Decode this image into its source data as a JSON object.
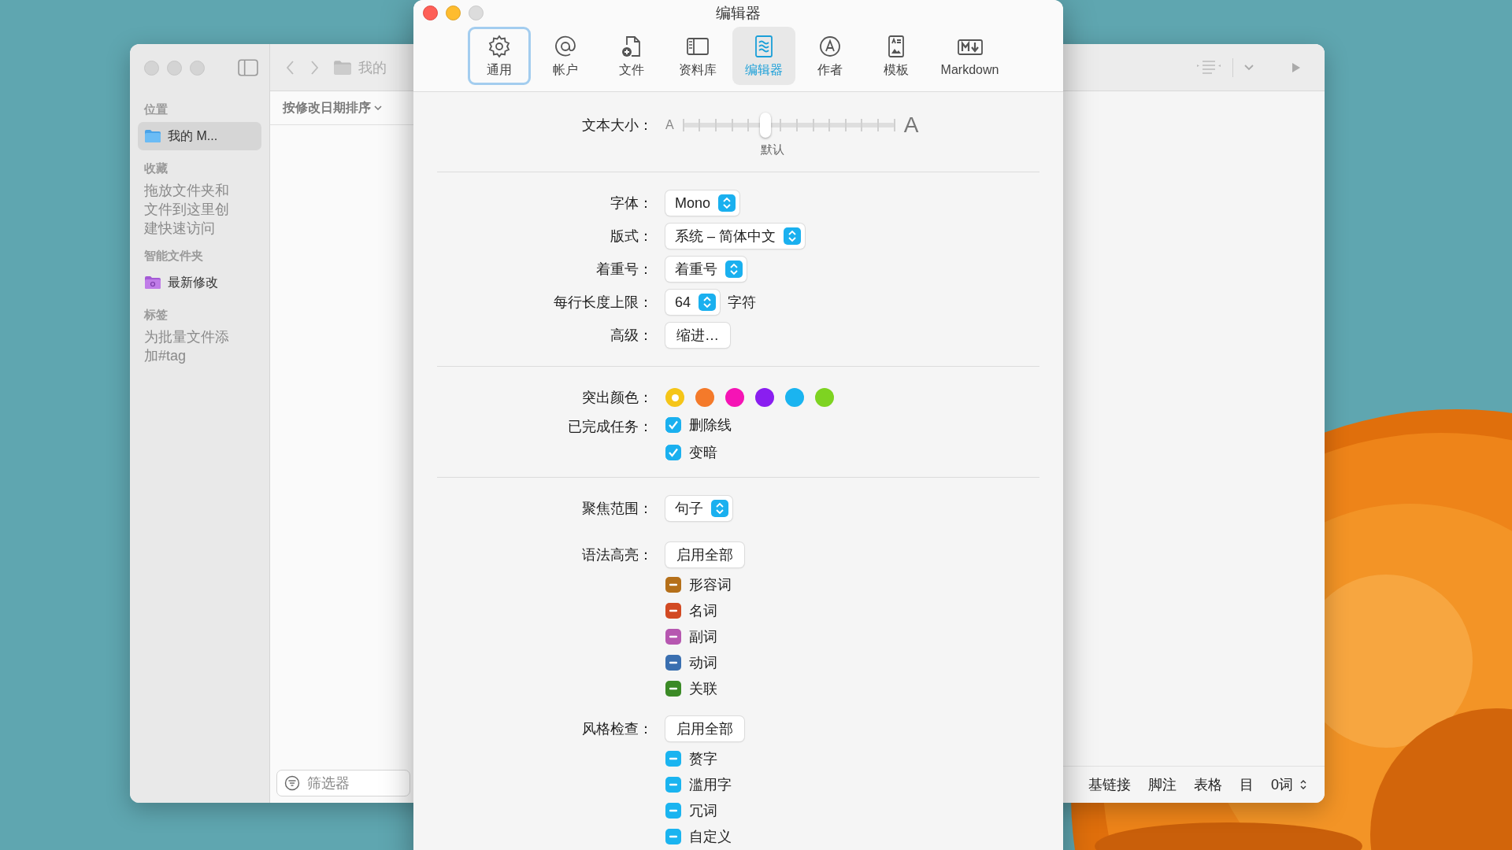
{
  "background_window": {
    "path": "我的",
    "sidebar": {
      "sections": [
        {
          "header": "位置",
          "items": [
            {
              "label": "我的 M...",
              "selected": true,
              "kind": "folder"
            }
          ]
        },
        {
          "header": "收藏",
          "hint": "拖放文件夹和文件到这里创建快速访问"
        },
        {
          "header": "智能文件夹",
          "items": [
            {
              "label": "最新修改",
              "selected": false,
              "kind": "smart"
            }
          ]
        },
        {
          "header": "标签",
          "hint": "为批量文件添加#tag"
        }
      ]
    },
    "sort": "按修改日期排序",
    "filter": {
      "placeholder": "筛选器"
    },
    "status_bar": [
      "基链接",
      "脚注",
      "表格",
      "目"
    ],
    "word_count": "0词"
  },
  "prefs_window": {
    "title": "编辑器",
    "tabs": [
      {
        "label": "通用",
        "selected": false,
        "focused": true
      },
      {
        "label": "帐户",
        "selected": false,
        "focused": false
      },
      {
        "label": "文件",
        "selected": false,
        "focused": false
      },
      {
        "label": "资料库",
        "selected": false,
        "focused": false
      },
      {
        "label": "编辑器",
        "selected": true,
        "focused": false
      },
      {
        "label": "作者",
        "selected": false,
        "focused": false
      },
      {
        "label": "模板",
        "selected": false,
        "focused": false
      },
      {
        "label": "Markdown",
        "selected": false,
        "focused": false
      }
    ],
    "text_size": {
      "label": "文本大小：",
      "small": "A",
      "large": "A",
      "level": 0.39,
      "caption": "默认"
    },
    "popups": [
      {
        "label": "字体：",
        "value": "Mono"
      },
      {
        "label": "版式：",
        "value": "系统 – 简体中文"
      },
      {
        "label": "着重号：",
        "value": "着重号"
      },
      {
        "label": "每行长度上限：",
        "value": "64",
        "suffix": "字符"
      }
    ],
    "advanced": {
      "label": "高级：",
      "button": "缩进…"
    },
    "accent": {
      "label": "突出颜色：",
      "colors": [
        {
          "color": "#f5c518",
          "selected": true
        },
        {
          "color": "#f47a2a",
          "selected": false
        },
        {
          "color": "#f514b5",
          "selected": false
        },
        {
          "color": "#8a1ef0",
          "selected": false
        },
        {
          "color": "#1ab4f0",
          "selected": false
        },
        {
          "color": "#7ed321",
          "selected": false
        }
      ]
    },
    "completed": {
      "label": "已完成任务：",
      "options": [
        {
          "label": "删除线",
          "checked": true
        },
        {
          "label": "变暗",
          "checked": true
        }
      ]
    },
    "focus": {
      "label": "聚焦范围：",
      "value": "句子"
    },
    "groups": [
      {
        "label": "语法高亮：",
        "button": "启用全部",
        "items": [
          {
            "label": "形容词",
            "color": "#b5701a"
          },
          {
            "label": "名词",
            "color": "#d24a23"
          },
          {
            "label": "副词",
            "color": "#b657b0"
          },
          {
            "label": "动词",
            "color": "#3a6fb0"
          },
          {
            "label": "关联",
            "color": "#3b8a26"
          }
        ]
      },
      {
        "label": "风格检查：",
        "button": "启用全部",
        "items": [
          {
            "label": "赘字",
            "color": "#1ab4f0"
          },
          {
            "label": "滥用字",
            "color": "#1ab4f0"
          },
          {
            "label": "冗词",
            "color": "#1ab4f0"
          },
          {
            "label": "自定义",
            "color": "#1ab4f0"
          }
        ]
      }
    ]
  }
}
